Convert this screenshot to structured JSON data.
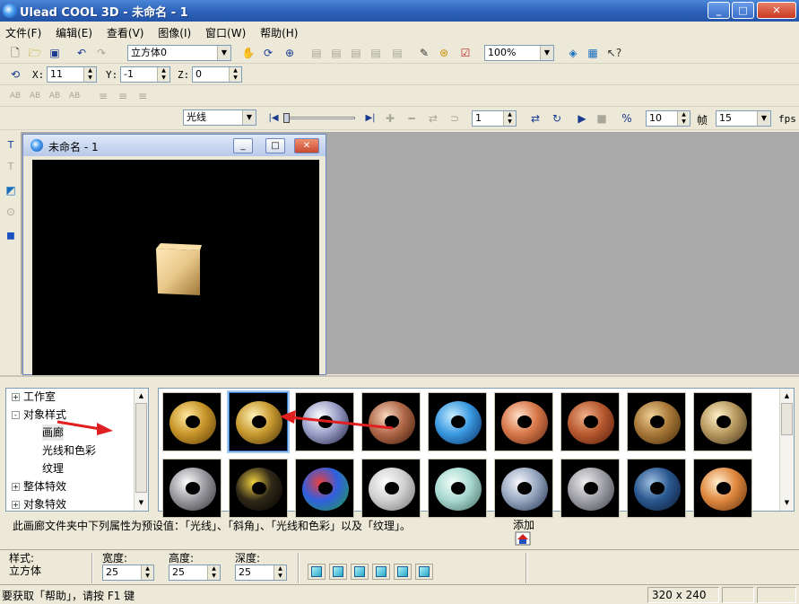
{
  "window": {
    "title": "Ulead COOL 3D - 未命名 - 1"
  },
  "menu": [
    "文件(F)",
    "编辑(E)",
    "查看(V)",
    "图像(I)",
    "窗口(W)",
    "帮助(H)"
  ],
  "toolbar1": {
    "object_combo": "立方体0",
    "zoom_combo": "100%"
  },
  "toolbar2": {
    "x_label": "X:",
    "x_value": "11",
    "y_label": "Y:",
    "y_value": "-1",
    "z_label": "Z:",
    "z_value": "0"
  },
  "toolbar3": {
    "text_buttons": [
      "AB",
      "AB",
      "AB",
      "AB"
    ]
  },
  "animbar": {
    "property_combo": "光线",
    "frame_value": "1",
    "total_frames": "10",
    "frames_label": "帧",
    "fps_value": "15",
    "fps_label": "fps"
  },
  "document": {
    "title": "未命名 - 1"
  },
  "tree": {
    "items": [
      {
        "label": "工作室",
        "expander": "+"
      },
      {
        "label": "对象样式",
        "expander": "-"
      },
      {
        "label": "画廊",
        "expander": ""
      },
      {
        "label": "光线和色彩",
        "expander": ""
      },
      {
        "label": "纹理",
        "expander": ""
      },
      {
        "label": "整体特效",
        "expander": "+"
      },
      {
        "label": "对象特效",
        "expander": "+"
      }
    ]
  },
  "gallery": {
    "presets": [
      {
        "name": "gold-ring",
        "colors": [
          "#ffe9a0",
          "#c8962a",
          "#5a3a08"
        ]
      },
      {
        "name": "gold-ring-ribbed",
        "colors": [
          "#fff2b8",
          "#c89a30",
          "#4a3008"
        ]
      },
      {
        "name": "chrome-glow-ring",
        "colors": [
          "#ffffff",
          "#9aa0c8",
          "#202040"
        ]
      },
      {
        "name": "copper-ring",
        "colors": [
          "#f8d8c0",
          "#b06848",
          "#3a1808"
        ]
      },
      {
        "name": "blue-bubble-ring",
        "colors": [
          "#c8ecff",
          "#3a9ae0",
          "#0a2860"
        ]
      },
      {
        "name": "coral-ring",
        "colors": [
          "#ffe0c8",
          "#d8784a",
          "#602810"
        ]
      },
      {
        "name": "terracotta-ring",
        "colors": [
          "#f0b088",
          "#b85a30",
          "#501808"
        ]
      },
      {
        "name": "bronze-dotted-ring",
        "colors": [
          "#f0d098",
          "#a87838",
          "#402808"
        ]
      },
      {
        "name": "studded-gold-ring",
        "colors": [
          "#fff0c8",
          "#b89a60",
          "#403018"
        ]
      },
      {
        "name": "silver-holes-ring",
        "colors": [
          "#ffffff",
          "#9a9aa0",
          "#303034"
        ]
      },
      {
        "name": "black-gold-ring",
        "colors": [
          "#f0d040",
          "#302818",
          "#000000"
        ]
      },
      {
        "name": "mosaic-ring",
        "colors": [
          "#e84040",
          "#3060e0",
          "#20a040"
        ]
      },
      {
        "name": "white-grid-ring",
        "colors": [
          "#ffffff",
          "#d0d0d0",
          "#707070"
        ]
      },
      {
        "name": "ice-ring",
        "colors": [
          "#f0fff8",
          "#a8d8d0",
          "#406860"
        ]
      },
      {
        "name": "silver-blue-ring",
        "colors": [
          "#f8f8ff",
          "#98a8c0",
          "#203050"
        ]
      },
      {
        "name": "riveted-ring",
        "colors": [
          "#f0f0f0",
          "#a0a0a8",
          "#404048"
        ]
      },
      {
        "name": "denim-ring",
        "colors": [
          "#a0c0e0",
          "#2a5890",
          "#0a1830"
        ]
      },
      {
        "name": "orange-copper-ring",
        "colors": [
          "#fff0d0",
          "#e08840",
          "#603008"
        ]
      }
    ]
  },
  "description": {
    "text": "此画廊文件夹中下列属性为预设值：「光线」、「斜角」、「光线和色彩」以及「纹理」。"
  },
  "add": {
    "label": "添加"
  },
  "properties": {
    "style_label": "样式:",
    "style_value": "立方体",
    "width_label": "宽度:",
    "width_value": "25",
    "height_label": "高度:",
    "height_value": "25",
    "depth_label": "深度:",
    "depth_value": "25"
  },
  "status": {
    "message": "要获取「帮助」，请按 F1 键",
    "size": "320 x 240"
  },
  "colors": {
    "title_bar": "#2d62b8",
    "workspace": "#aaaaaa",
    "canvas": "#000000",
    "cube_face": "#e8c88a",
    "annotation_arrow": "#e02020"
  }
}
